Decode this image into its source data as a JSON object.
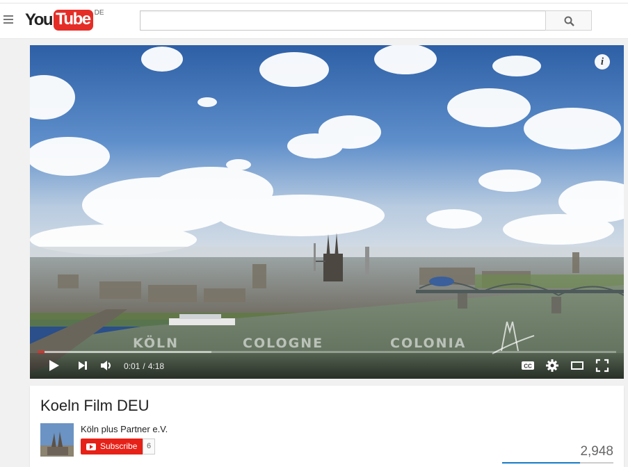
{
  "header": {
    "logo_you": "You",
    "logo_tube": "Tube",
    "region": "DE",
    "search_value": "",
    "icons": {
      "menu": "hamburger-icon",
      "search": "search-icon"
    }
  },
  "player": {
    "overlay_words": [
      "KÖLN",
      "COLOGNE",
      "COLONIA"
    ],
    "current_time": "0:01",
    "separator": "/",
    "duration": "4:18",
    "progress": {
      "played_fraction": 0.012,
      "loaded_fraction": 0.3
    },
    "icons": {
      "info": "info-icon",
      "play": "play-icon",
      "next": "next-icon",
      "volume": "volume-icon",
      "captions": "cc-icon",
      "settings": "gear-icon",
      "theater": "theater-mode-icon",
      "fullscreen": "fullscreen-icon",
      "watermark": "cologne-logo-icon"
    },
    "colors": {
      "progress_played": "#e52d27"
    }
  },
  "video_info": {
    "title": "Koeln Film DEU",
    "channel_name": "Köln plus Partner e.V.",
    "subscribe_label": "Subscribe",
    "subscriber_count": "6",
    "view_count": "2,948",
    "like_fraction": 0.7
  },
  "info_icon_glyph": "i"
}
